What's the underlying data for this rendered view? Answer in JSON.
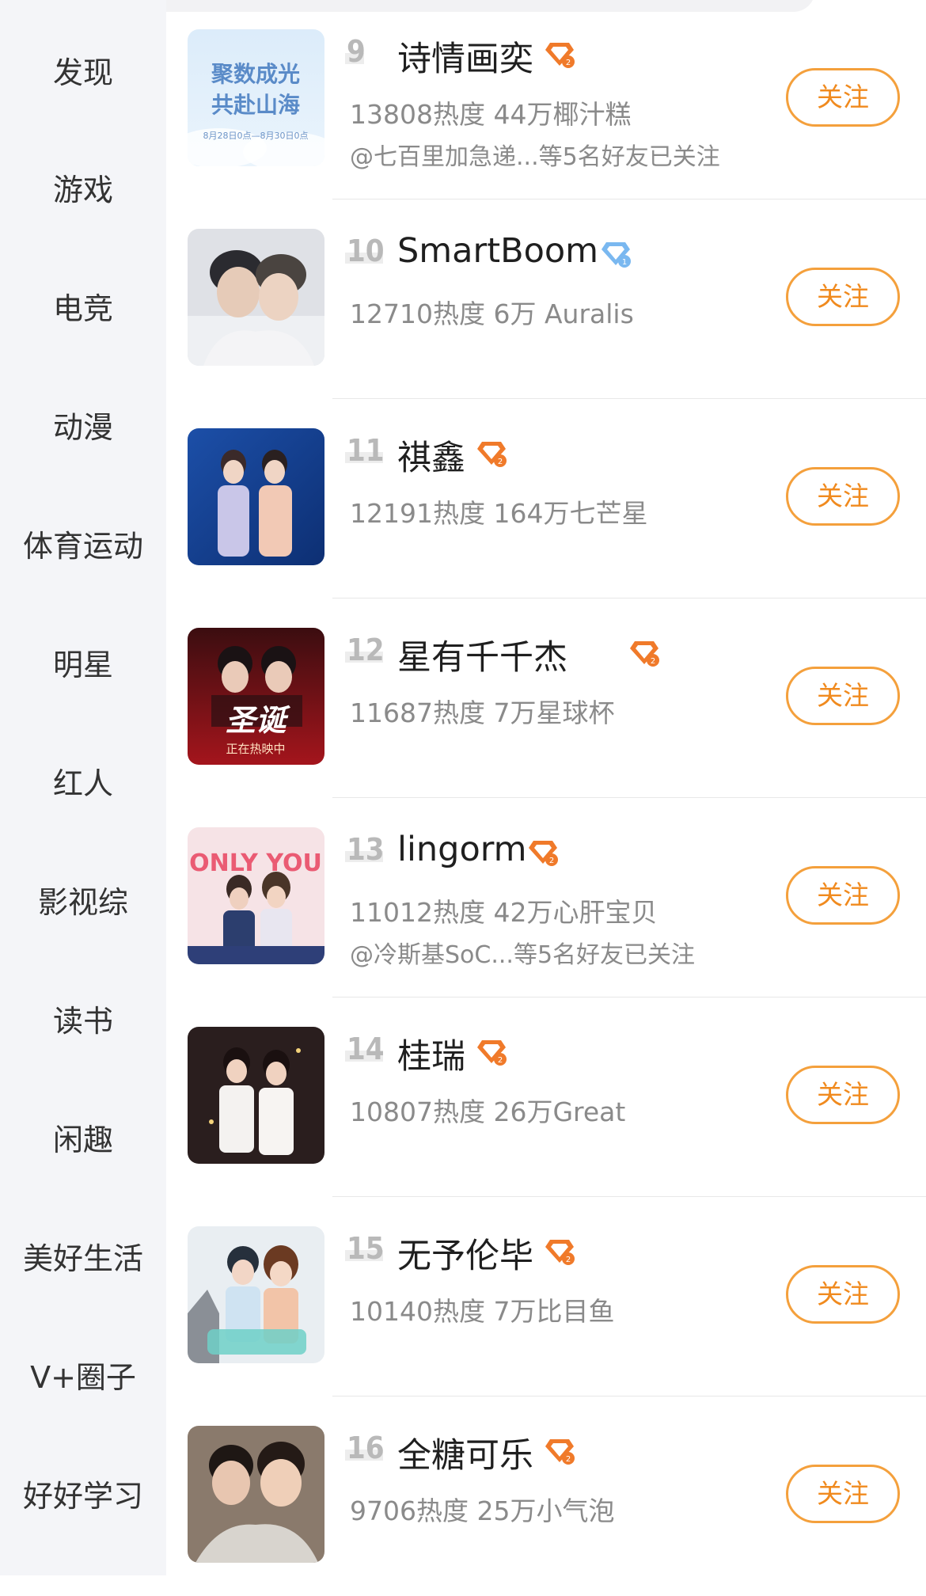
{
  "sidebar": {
    "items": [
      {
        "label": "发现"
      },
      {
        "label": "游戏"
      },
      {
        "label": "电竞"
      },
      {
        "label": "动漫"
      },
      {
        "label": "体育运动"
      },
      {
        "label": "明星"
      },
      {
        "label": "红人"
      },
      {
        "label": "影视综"
      },
      {
        "label": "读书"
      },
      {
        "label": "闲趣"
      },
      {
        "label": "美好生活"
      },
      {
        "label": "V+圈子"
      },
      {
        "label": "好好学习"
      }
    ]
  },
  "list": {
    "follow_label": "关注",
    "items": [
      {
        "rank": "9",
        "name": "诗情画奕",
        "badge": "orange",
        "stats": "13808热度 44万椰汁糕",
        "friends": "@七百里加急递...等5名好友已关注",
        "thumb_text": [
          "聚数成光",
          "共赴山海",
          "8月28日0点—8月30日0点"
        ]
      },
      {
        "rank": "10",
        "name": "SmartBoom",
        "badge": "blue",
        "stats": "12710热度 6万 Auralis",
        "friends": ""
      },
      {
        "rank": "11",
        "name": "祺鑫",
        "badge": "orange",
        "stats": "12191热度 164万七芒星",
        "friends": ""
      },
      {
        "rank": "12",
        "name": "星有千千杰",
        "badge": "orange",
        "stats": "11687热度 7万星球杯",
        "friends": "",
        "thumb_text": [
          "正在热映中"
        ]
      },
      {
        "rank": "13",
        "name": "lingorm",
        "badge": "orange",
        "stats": "11012热度 42万心肝宝贝",
        "friends": "@冷斯基SoC...等5名好友已关注",
        "thumb_text": [
          "ONLY YOU"
        ]
      },
      {
        "rank": "14",
        "name": "桂瑞",
        "badge": "orange",
        "stats": "10807热度 26万Great",
        "friends": ""
      },
      {
        "rank": "15",
        "name": "无予伦毕",
        "badge": "orange",
        "stats": "10140热度 7万比目鱼",
        "friends": ""
      },
      {
        "rank": "16",
        "name": "全糖可乐",
        "badge": "orange",
        "stats": "9706热度 25万小气泡",
        "friends": ""
      }
    ]
  },
  "colors": {
    "accent": "#f08a1e",
    "badge_orange": "#f07a2a",
    "badge_blue": "#7ab8f0",
    "sidebar_bg": "#f4f5f8"
  }
}
